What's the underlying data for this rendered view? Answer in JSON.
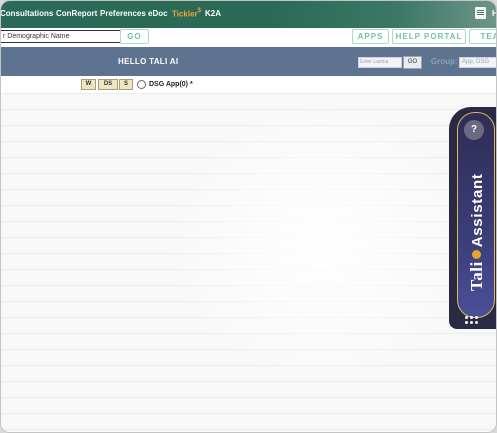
{
  "nav": {
    "items": [
      "Consultations",
      "ConReport",
      "Preferences",
      "eDoc",
      "Tickler",
      "K2A"
    ],
    "tickler_sup": "$",
    "right_text": "H"
  },
  "search": {
    "value": "r Demographic Name",
    "go_label": "GO"
  },
  "links": {
    "apps": "APPS",
    "help_portal": "HELP PORTAL",
    "team": "TEA"
  },
  "header": {
    "title": "HELLO TALI AI",
    "lastname_placeholder": "Enter Lastna",
    "go_label": "GO",
    "group_label": "Group:",
    "group_value": "App, DSG"
  },
  "subrow": {
    "buttons": [
      "W",
      "DS",
      "S"
    ],
    "dsg_label": "DSG App(0) *"
  },
  "assistant": {
    "help_symbol": "?",
    "word_tali": "Tali",
    "word_assistant": "Assistant"
  },
  "colors": {
    "nav_bg": "#2b6a58",
    "tickler": "#f0a63a",
    "header_band": "#5e7390",
    "outline_btn": "#74c2a6",
    "assistant_bg": "#2a2a45",
    "assistant_accent": "#e8a52e"
  }
}
